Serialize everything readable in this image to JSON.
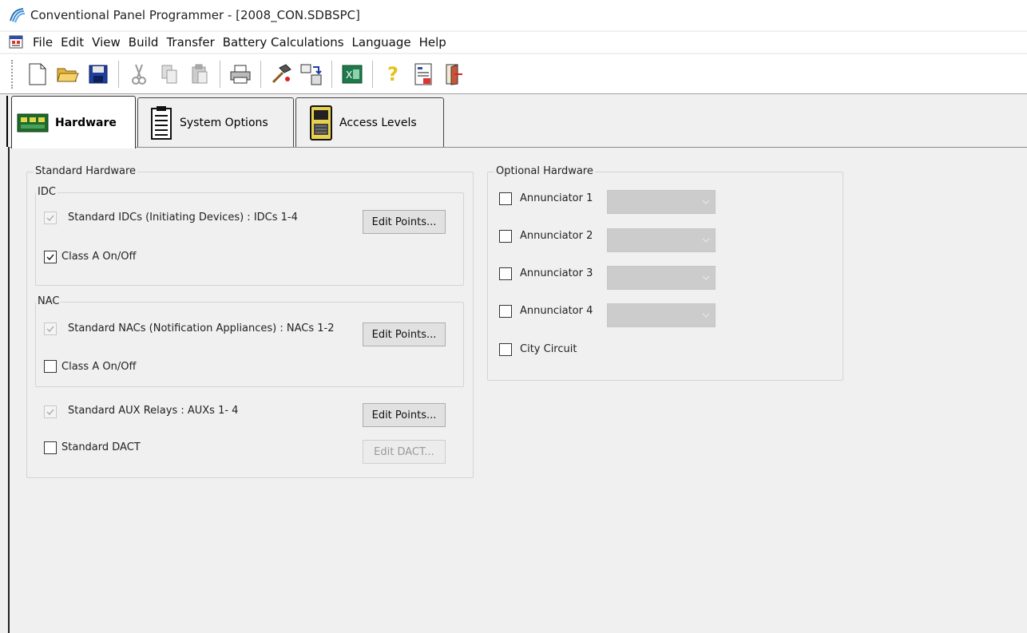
{
  "window": {
    "title": "Conventional Panel Programmer - [2008_CON.SDBSPC]"
  },
  "menu": [
    "File",
    "Edit",
    "View",
    "Build",
    "Transfer",
    "Battery Calculations",
    "Language",
    "Help"
  ],
  "toolbar": {
    "icons": [
      "new-file-icon",
      "open-folder-icon",
      "save-icon",
      "cut-icon",
      "copy-icon",
      "paste-icon",
      "print-icon",
      "build-hammer-icon",
      "transfer-icon",
      "excel-icon",
      "help-icon",
      "battery-calc-icon",
      "exit-door-icon"
    ]
  },
  "tabs": [
    {
      "label": "Hardware",
      "active": true
    },
    {
      "label": "System Options",
      "active": false
    },
    {
      "label": "Access Levels",
      "active": false
    }
  ],
  "standard_hardware": {
    "title": "Standard Hardware",
    "idc": {
      "title": "IDC",
      "std_label": "Standard IDCs (Initiating Devices) : IDCs 1-4",
      "std_checked": true,
      "edit_button": "Edit Points...",
      "class_a_label": "Class A On/Off",
      "class_a_checked": true
    },
    "nac": {
      "title": "NAC",
      "std_label": "Standard NACs (Notification Appliances) : NACs 1-2",
      "std_checked": true,
      "edit_button": "Edit Points...",
      "class_a_label": "Class A On/Off",
      "class_a_checked": false
    },
    "aux": {
      "label": "Standard AUX Relays : AUXs 1- 4",
      "checked": true,
      "edit_button": "Edit Points..."
    },
    "dact": {
      "label": "Standard DACT",
      "checked": false,
      "edit_button": "Edit DACT..."
    }
  },
  "optional_hardware": {
    "title": "Optional Hardware",
    "annunciators": [
      {
        "label": "Annunciator 1",
        "checked": false
      },
      {
        "label": "Annunciator 2",
        "checked": false
      },
      {
        "label": "Annunciator 3",
        "checked": false
      },
      {
        "label": "Annunciator 4",
        "checked": false
      }
    ],
    "city_circuit": {
      "label": "City Circuit",
      "checked": false
    }
  }
}
